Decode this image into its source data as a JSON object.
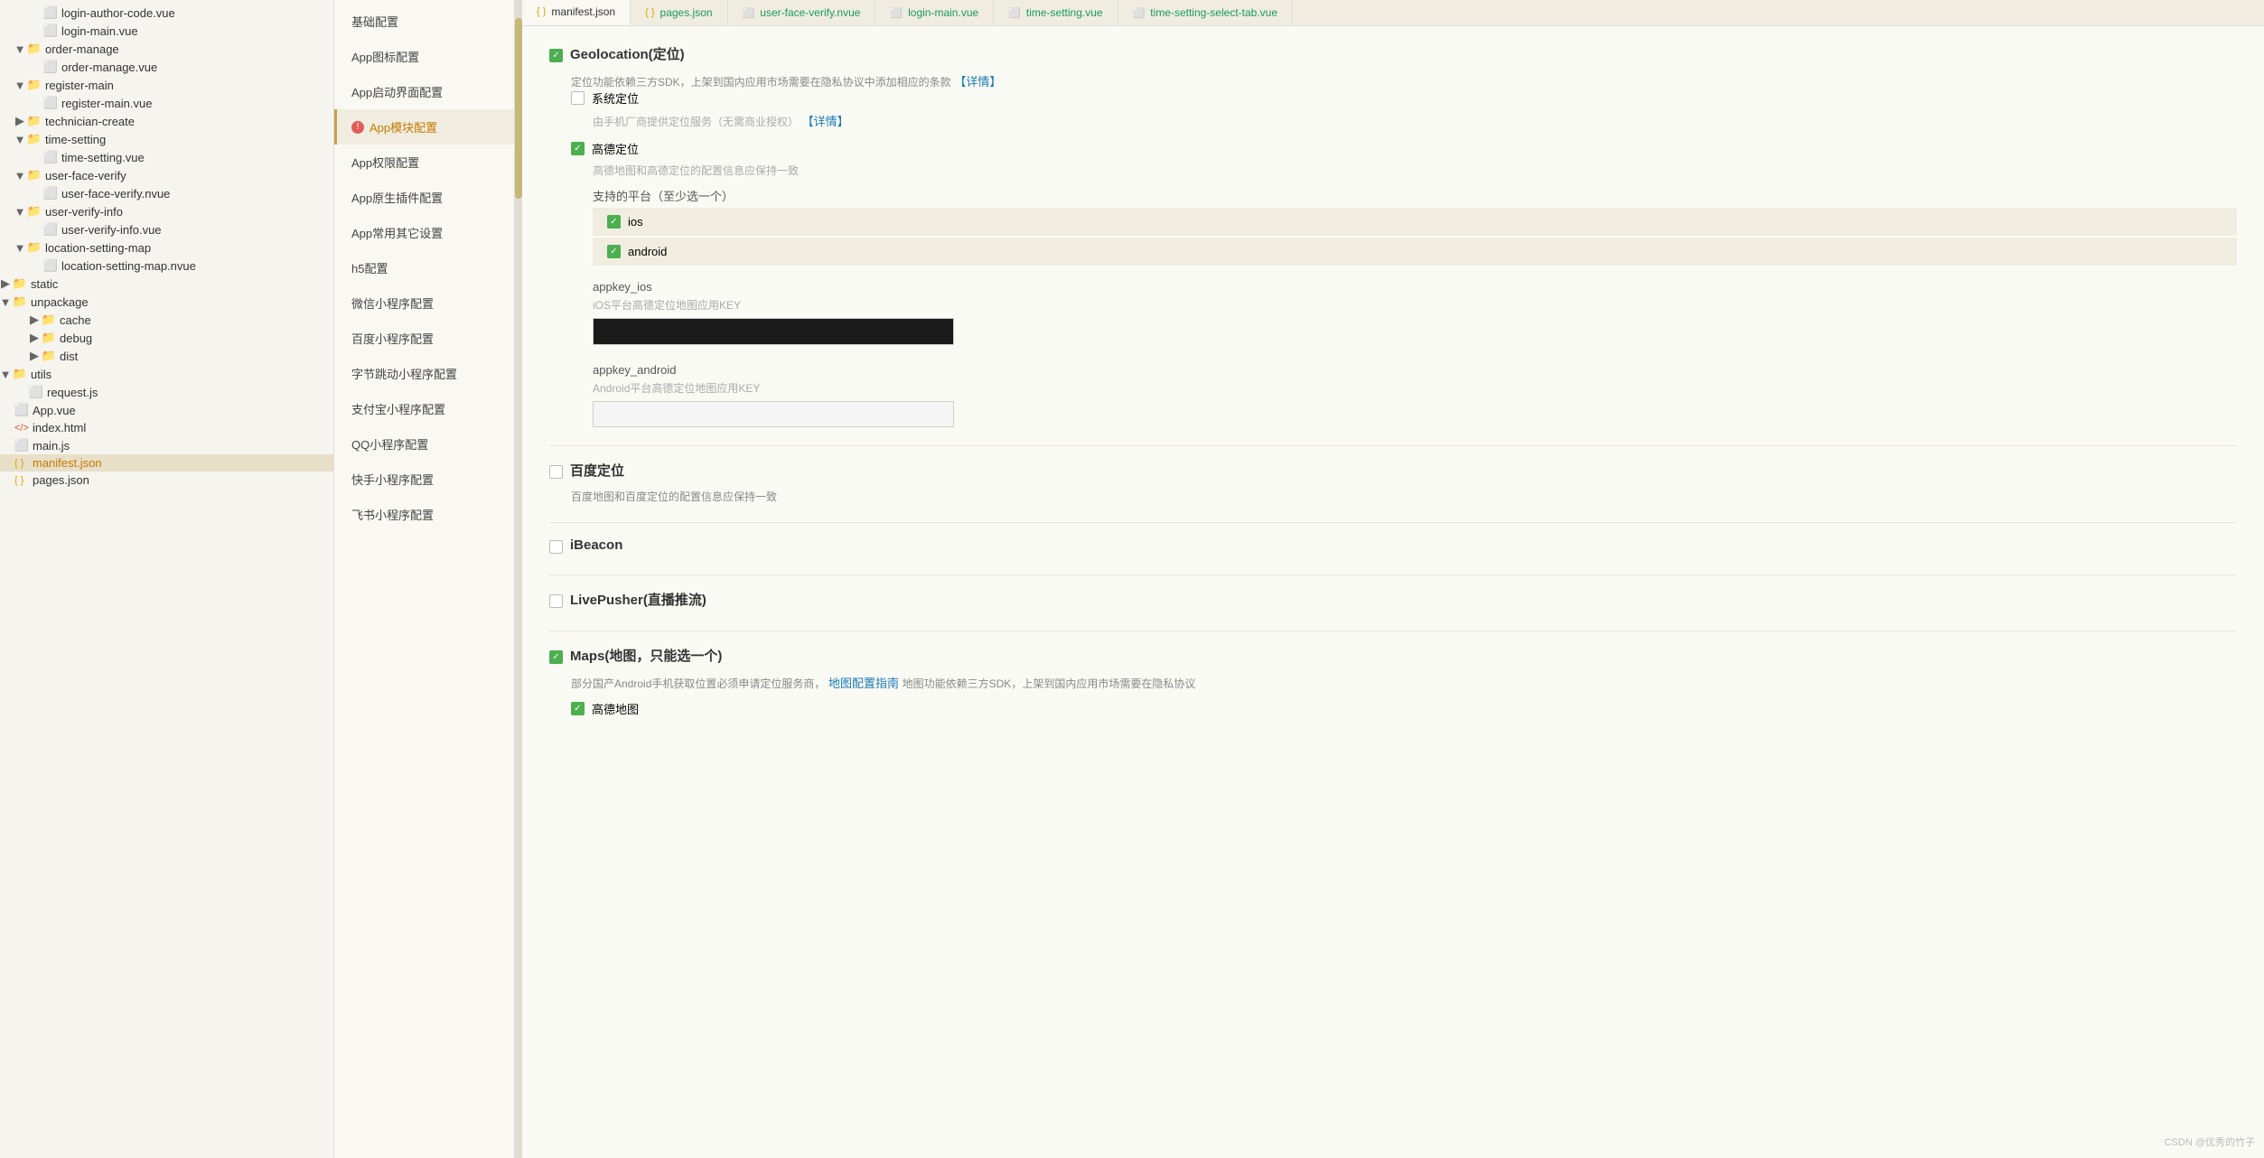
{
  "fileTree": {
    "items": [
      {
        "id": "login-author-code",
        "label": "login-author-code.vue",
        "type": "vue",
        "indent": 2
      },
      {
        "id": "login-main",
        "label": "login-main.vue",
        "type": "vue",
        "indent": 2
      },
      {
        "id": "order-manage-folder",
        "label": "order-manage",
        "type": "folder-open",
        "indent": 1
      },
      {
        "id": "order-manage-vue",
        "label": "order-manage.vue",
        "type": "vue",
        "indent": 2
      },
      {
        "id": "register-main-folder",
        "label": "register-main",
        "type": "folder-open",
        "indent": 1
      },
      {
        "id": "register-main-vue",
        "label": "register-main.vue",
        "type": "vue",
        "indent": 2
      },
      {
        "id": "technician-create-folder",
        "label": "technician-create",
        "type": "folder",
        "indent": 1
      },
      {
        "id": "time-setting-folder",
        "label": "time-setting",
        "type": "folder-open",
        "indent": 1
      },
      {
        "id": "time-setting-vue",
        "label": "time-setting.vue",
        "type": "vue",
        "indent": 2
      },
      {
        "id": "user-face-verify-folder",
        "label": "user-face-verify",
        "type": "folder-open",
        "indent": 1
      },
      {
        "id": "user-face-verify-nvue",
        "label": "user-face-verify.nvue",
        "type": "nvue",
        "indent": 2
      },
      {
        "id": "user-verify-info-folder",
        "label": "user-verify-info",
        "type": "folder-open",
        "indent": 1
      },
      {
        "id": "user-verify-info-vue",
        "label": "user-verify-info.vue",
        "type": "vue",
        "indent": 2
      },
      {
        "id": "location-setting-map-folder",
        "label": "location-setting-map",
        "type": "folder-open",
        "indent": 1
      },
      {
        "id": "location-setting-map-nvue",
        "label": "location-setting-map.nvue",
        "type": "nvue",
        "indent": 2
      },
      {
        "id": "static-folder",
        "label": "static",
        "type": "folder",
        "indent": 0
      },
      {
        "id": "unpackage-folder",
        "label": "unpackage",
        "type": "folder-open",
        "indent": 0
      },
      {
        "id": "cache-folder",
        "label": "cache",
        "type": "folder",
        "indent": 1
      },
      {
        "id": "debug-folder",
        "label": "debug",
        "type": "folder",
        "indent": 1
      },
      {
        "id": "dist-folder",
        "label": "dist",
        "type": "folder",
        "indent": 1
      },
      {
        "id": "utils-folder",
        "label": "utils",
        "type": "folder-open",
        "indent": 0
      },
      {
        "id": "request-js",
        "label": "request.js",
        "type": "js",
        "indent": 1
      },
      {
        "id": "app-vue",
        "label": "App.vue",
        "type": "vue",
        "indent": 0
      },
      {
        "id": "index-html",
        "label": "index.html",
        "type": "html",
        "indent": 0
      },
      {
        "id": "main-js",
        "label": "main.js",
        "type": "js",
        "indent": 0
      },
      {
        "id": "manifest-json",
        "label": "manifest.json",
        "type": "json",
        "indent": 0,
        "active": true,
        "highlighted": true
      },
      {
        "id": "pages-json",
        "label": "pages.json",
        "type": "json",
        "indent": 0
      }
    ]
  },
  "configNav": {
    "items": [
      {
        "id": "basic",
        "label": "基础配置"
      },
      {
        "id": "app-icon",
        "label": "App图标配置"
      },
      {
        "id": "app-splash",
        "label": "App启动界面配置"
      },
      {
        "id": "app-modules",
        "label": "App模块配置",
        "active": true,
        "hasError": true
      },
      {
        "id": "app-permissions",
        "label": "App权限配置"
      },
      {
        "id": "app-native-plugins",
        "label": "App原生插件配置"
      },
      {
        "id": "app-other",
        "label": "App常用其它设置"
      },
      {
        "id": "h5",
        "label": "h5配置"
      },
      {
        "id": "weixin-miniapp",
        "label": "微信小程序配置"
      },
      {
        "id": "baidu-miniapp",
        "label": "百度小程序配置"
      },
      {
        "id": "bytedance-miniapp",
        "label": "字节跳动小程序配置"
      },
      {
        "id": "alipay-miniapp",
        "label": "支付宝小程序配置"
      },
      {
        "id": "qq-miniapp",
        "label": "QQ小程序配置"
      },
      {
        "id": "kuaishou-miniapp",
        "label": "快手小程序配置"
      },
      {
        "id": "more-miniapp",
        "label": "飞书小程序配置"
      }
    ]
  },
  "tabs": [
    {
      "id": "manifest",
      "label": "manifest.json",
      "active": true
    },
    {
      "id": "pages",
      "label": "pages.json",
      "color": "green"
    },
    {
      "id": "user-face-verify",
      "label": "user-face-verify.nvue",
      "color": "green"
    },
    {
      "id": "login-main",
      "label": "login-main.vue",
      "color": "green"
    },
    {
      "id": "time-setting",
      "label": "time-setting.vue",
      "color": "green"
    },
    {
      "id": "time-setting-select",
      "label": "time-setting-select-tab.vue",
      "color": "green"
    }
  ],
  "content": {
    "geolocation": {
      "title": "Geolocation(定位)",
      "checked": true,
      "desc": "定位功能依赖三方SDK，上架到国内应用市场需要在隐私协议中添加相应的条款",
      "detailLink": "【详情】",
      "systemLocation": {
        "label": "系统定位",
        "checked": false,
        "desc": "由手机厂商提供定位服务（无需商业授权）",
        "detailLink": "【详情】"
      },
      "amap": {
        "label": "高德定位",
        "checked": true,
        "desc": "高德地图和高德定位的配置信息应保持一致",
        "platformTitle": "支持的平台（至少选一个）",
        "platforms": [
          {
            "id": "ios",
            "label": "ios",
            "checked": true
          },
          {
            "id": "android",
            "label": "android",
            "checked": true
          }
        ],
        "appkeyIos": {
          "label": "appkey_ios",
          "hint": "iOS平台高德定位地图应用KEY",
          "value": "••••••••••••••••••••••••••••••••"
        },
        "appkeyAndroid": {
          "label": "appkey_android",
          "hint": "Android平台高德定位地图应用KEY",
          "value": ""
        }
      }
    },
    "baiduLocation": {
      "label": "百度定位",
      "checked": false,
      "desc": "百度地图和百度定位的配置信息应保持一致"
    },
    "iBeacon": {
      "label": "iBeacon",
      "checked": false
    },
    "livePusher": {
      "label": "LivePusher(直播推流)",
      "checked": false
    },
    "maps": {
      "label": "Maps(地图，只能选一个)",
      "checked": true,
      "desc": "部分国产Android手机获取位置必须申请定位服务商，",
      "mapConfigLink": "地图配置指南",
      "desc2": "地图功能依赖三方SDK，上架到国内应用市场需要在隐私协议",
      "amap": {
        "label": "高德地图",
        "checked": true
      }
    }
  },
  "watermark": {
    "text": "CSDN @优秀的竹子"
  }
}
